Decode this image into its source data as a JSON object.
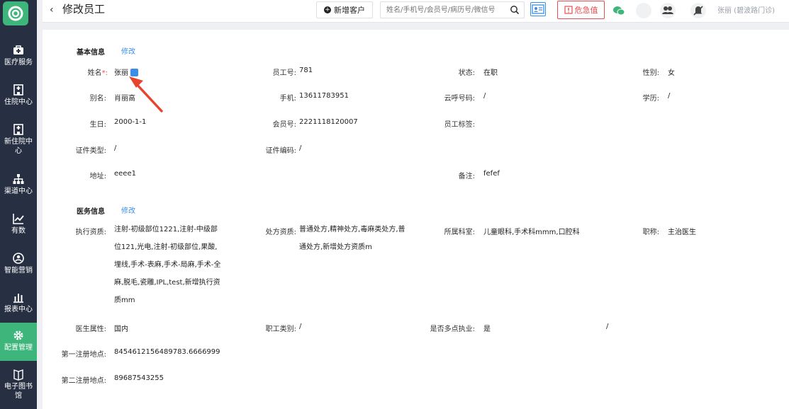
{
  "sidebar": {
    "items": [
      {
        "label": "医疗服务",
        "icon": "medical-kit-icon"
      },
      {
        "label": "住院中心",
        "icon": "hospital-icon"
      },
      {
        "label": "新住院中心",
        "icon": "hospital-icon"
      },
      {
        "label": "渠道中心",
        "icon": "org-chart-icon"
      },
      {
        "label": "有数",
        "icon": "trend-chart-icon"
      },
      {
        "label": "智能营销",
        "icon": "marketing-icon"
      },
      {
        "label": "报表中心",
        "icon": "bar-chart-icon"
      },
      {
        "label": "配置管理",
        "icon": "gear-icon"
      },
      {
        "label": "电子图书馆",
        "icon": "book-icon"
      }
    ],
    "active_index": 7,
    "accent": "#3eb57a"
  },
  "header": {
    "title": "修改员工",
    "new_customer": "新增客户",
    "search_placeholder": "姓名/手机号/会员号/病历号/微信号",
    "danger_label": "危急值",
    "user": "张丽 (碧波路门诊)"
  },
  "basic": {
    "section_title": "基本信息",
    "edit": "修改",
    "rows": {
      "name_label": "姓名",
      "name_req": "*:",
      "name": "张丽",
      "staff_no_label": "员工号:",
      "staff_no": "781",
      "status_label": "状态:",
      "status": "在职",
      "gender_label": "性别:",
      "gender": "女",
      "alias_label": "别名:",
      "alias": "肖丽高",
      "phone_label": "手机:",
      "phone": "13611783951",
      "cloud_label": "云呼号码:",
      "cloud": "/",
      "edu_label": "学历:",
      "edu": "/",
      "birthday_label": "生日:",
      "birthday": "2000-1-1",
      "member_label": "会员号:",
      "member": "2221118120007",
      "tag_label": "员工标签:",
      "id_type_label": "证件类型:",
      "id_type": "/",
      "id_code_label": "证件编码:",
      "id_code": "/",
      "address_label": "地址:",
      "address": "eeee1",
      "remark_label": "备注:",
      "remark": "fefef"
    }
  },
  "medical": {
    "section_title": "医务信息",
    "edit": "修改",
    "rows": {
      "practice_label": "执行资质:",
      "practice": "注射-初级部位1221,注射-中级部位121,光电,注射-初级部位,果酸,埋线,手术-表麻,手术-局麻,手术-全麻,脱毛,瓷雕,IPL,test,新增执行资质mm",
      "prescription_label": "处方资质:",
      "prescription": "普通处方,精神处方,毒麻类处方,普通处方,新增处方资质m",
      "dept_label": "所属科室:",
      "dept": "儿童眼科,手术科mmm,口腔科",
      "title_label": "职称:",
      "title": "主治医生",
      "doctor_attr_label": "医生属性:",
      "doctor_attr": "国内",
      "job_type_label": "职工类别:",
      "job_type": "/",
      "multi_site_label": "是否多点执业:",
      "multi_site": "是",
      "multi_site_extra": "/",
      "reg1_label": "第一注册地点:",
      "reg1": "8454612156489783.6666999",
      "reg2_label": "第二注册地点:",
      "reg2": "89687543255"
    }
  },
  "annotation": {
    "color": "#e8432e"
  }
}
